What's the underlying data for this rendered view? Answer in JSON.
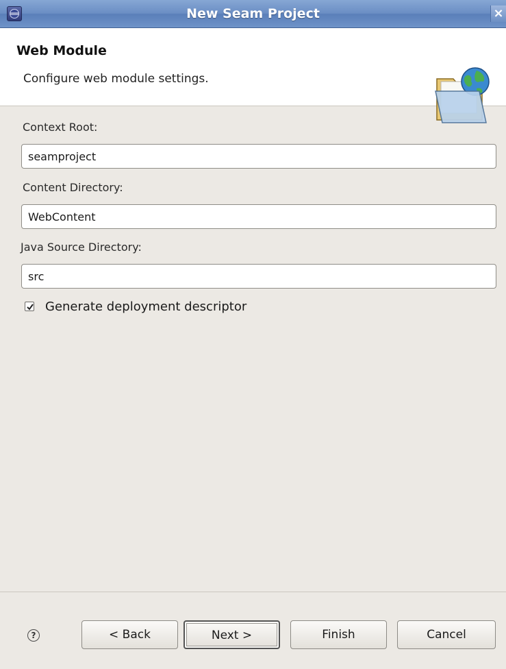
{
  "window": {
    "title": "New Seam Project",
    "close_symbol": "×",
    "icon": "eclipse-icon"
  },
  "header": {
    "title": "Web Module",
    "description": "Configure web module settings.",
    "icon": "folder-globe-icon"
  },
  "form": {
    "context_root_label": "Context Root:",
    "context_root_value": "seamproject",
    "content_dir_label": "Content Directory:",
    "content_dir_value": "WebContent",
    "java_src_label": "Java Source Directory:",
    "java_src_value": "src",
    "generate_dd_label": "Generate deployment descriptor",
    "generate_dd_checked": true
  },
  "footer": {
    "help_symbol": "?",
    "back_label": "< Back",
    "next_label": "Next >",
    "finish_label": "Finish",
    "cancel_label": "Cancel"
  },
  "colors": {
    "titlebar": "#6b8ec4",
    "dialog_bg": "#ece9e4",
    "header_bg": "#ffffff"
  }
}
